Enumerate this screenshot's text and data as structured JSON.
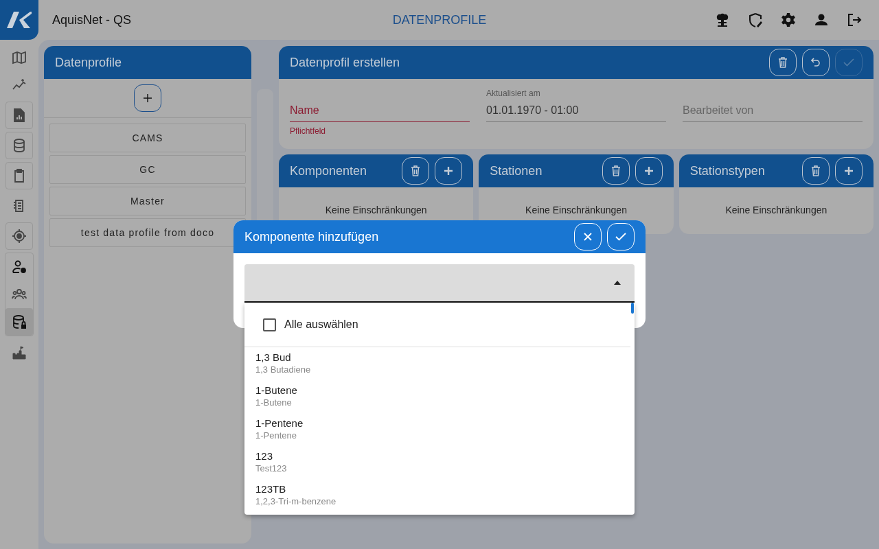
{
  "app": {
    "title": "AquisNet - QS",
    "page_title": "DATENPROFILE"
  },
  "nav": [
    {
      "framed": false,
      "items": [
        {
          "kind": "map",
          "selected": false
        },
        {
          "kind": "trend",
          "selected": false
        }
      ]
    },
    {
      "framed": true,
      "items": [
        {
          "kind": "report",
          "selected": false
        }
      ]
    },
    {
      "framed": true,
      "items": [
        {
          "kind": "database",
          "selected": false
        }
      ]
    },
    {
      "framed": true,
      "items": [
        {
          "kind": "clipboard",
          "selected": false
        }
      ]
    },
    {
      "framed": false,
      "items": [
        {
          "kind": "layers",
          "selected": false
        }
      ]
    },
    {
      "framed": true,
      "items": [
        {
          "kind": "target",
          "selected": false
        }
      ]
    },
    {
      "framed": true,
      "items": [
        {
          "kind": "user-gear",
          "selected": false
        },
        {
          "kind": "group",
          "selected": false
        },
        {
          "kind": "database-lock",
          "selected": true
        }
      ]
    },
    {
      "framed": false,
      "items": [
        {
          "kind": "castle",
          "selected": false
        }
      ]
    }
  ],
  "profiles_panel": {
    "title": "Datenprofile",
    "profiles": [
      "CAMS",
      "GC",
      "Master",
      "test data profile from doco"
    ]
  },
  "form_panel": {
    "title": "Datenprofil erstellen",
    "actions": [
      {
        "kind": "delete",
        "disabled": false
      },
      {
        "kind": "undo",
        "disabled": false
      },
      {
        "kind": "confirm",
        "disabled": true
      }
    ],
    "fields": [
      {
        "label": "Name",
        "error": "Pflichtfeld"
      },
      {
        "label": "Aktualisiert am",
        "value": "01.01.1970 - 01:00"
      },
      {
        "label": "Bearbeitet von"
      }
    ]
  },
  "cards": [
    {
      "title": "Komponenten",
      "empty_text": "Keine Einschränkungen"
    },
    {
      "title": "Stationen",
      "empty_text": "Keine Einschränkungen"
    },
    {
      "title": "Stationstypen",
      "empty_text": "Keine Einschränkungen"
    }
  ],
  "dialog": {
    "title": "Komponente hinzufügen",
    "select": {
      "expanded": true
    },
    "menu": {
      "select_all": {
        "label": "Alle auswählen",
        "checked": false
      },
      "options": [
        {
          "name": "1,3 Bud",
          "description": "1,3 Butadiene"
        },
        {
          "name": "1-Butene",
          "description": "1-Butene"
        },
        {
          "name": "1-Pentene",
          "description": "1-Pentene"
        },
        {
          "name": "123",
          "description": "Test123"
        },
        {
          "name": "123TB",
          "description": "1,2,3-Tri-m-benzene"
        }
      ]
    }
  }
}
